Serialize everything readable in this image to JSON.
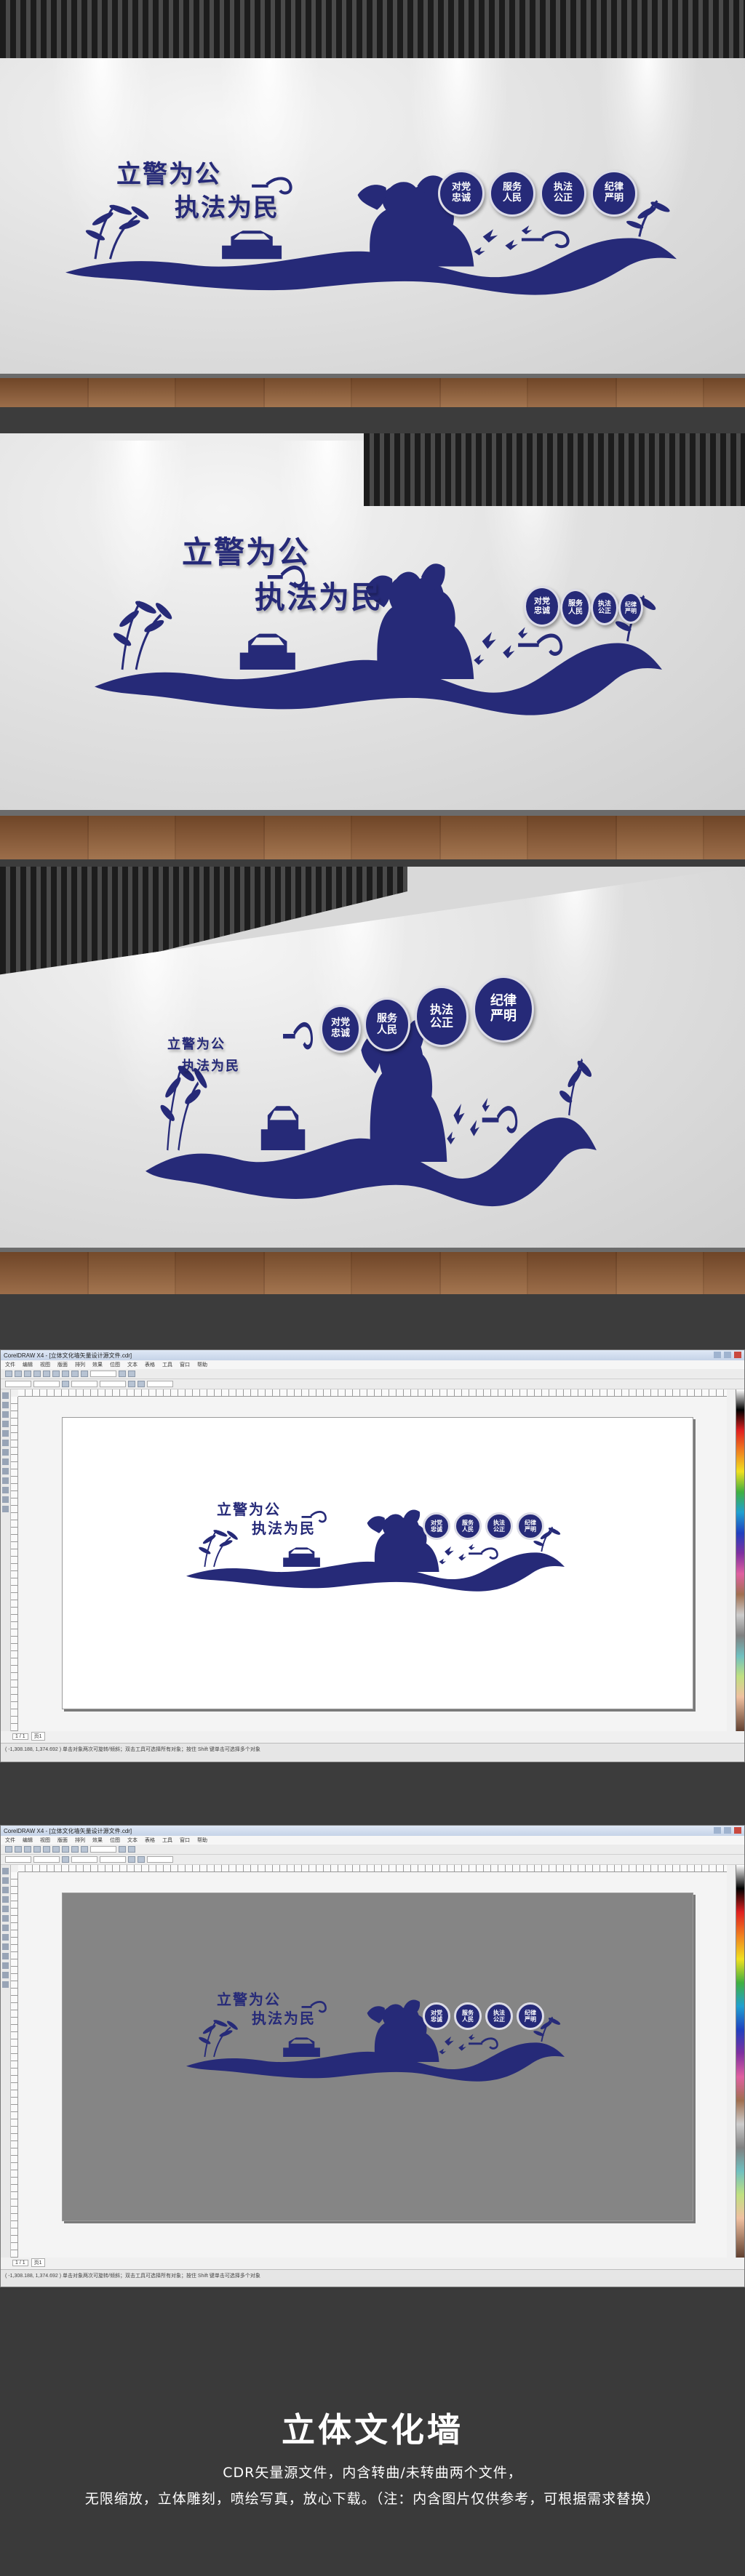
{
  "colors": {
    "mural_navy": "#262a78",
    "background_dark": "#3a3a3a",
    "footer_text": "#ffffff",
    "badge_text": "#ffffff"
  },
  "mural": {
    "slogan_line1": "立警为公",
    "slogan_line2": "执法为民",
    "badges": [
      {
        "line1": "对党",
        "line2": "忠诚"
      },
      {
        "line1": "服务",
        "line2": "人民"
      },
      {
        "line1": "执法",
        "line2": "公正"
      },
      {
        "line1": "纪律",
        "line2": "严明"
      }
    ],
    "icons": [
      "saluting-police-silhouette-icon",
      "bamboo-icon",
      "auspicious-cloud-icon",
      "doves-icon",
      "gate-tower-icon"
    ]
  },
  "software": {
    "window_title": "CorelDRAW X4 - [立体文化墙矢量设计源文件.cdr]",
    "menu_items": [
      "文件",
      "编辑",
      "视图",
      "版面",
      "排列",
      "效果",
      "位图",
      "文本",
      "表格",
      "工具",
      "窗口",
      "帮助"
    ],
    "page_tab_label": "页1",
    "page_counter": "1 / 1",
    "status_text": "(  -1,308.188, 1,374.692  )  单击对象两次可旋转/倾斜；双击工具可选择所有对象；按住 Shift 键单击可选择多个对象",
    "workspace_backgrounds": [
      "#ffffff",
      "#858585"
    ]
  },
  "footer": {
    "title": "立体文化墙",
    "line1": "CDR矢量源文件，内含转曲/未转曲两个文件，",
    "line2": "无限缩放，立体雕刻，喷绘写真，放心下载。（注：内含图片仅供参考，可根据需求替换）"
  }
}
